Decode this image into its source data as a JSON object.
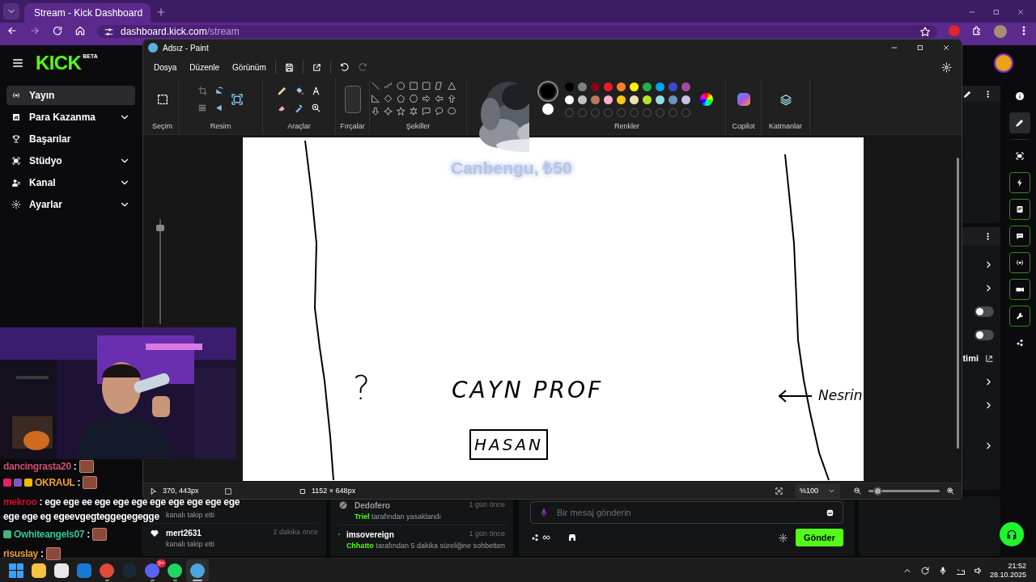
{
  "browser": {
    "tab": {
      "title": "Stream - Kick Dashboard"
    },
    "address": {
      "host": "dashboard.kick.com",
      "path": "/stream"
    }
  },
  "kick": {
    "logo": "KICK",
    "logo_badge": "BETA",
    "sidebar": [
      {
        "label": "Yayın",
        "selected": true,
        "expandable": false
      },
      {
        "label": "Para Kazanma",
        "selected": false,
        "expandable": true
      },
      {
        "label": "Başarılar",
        "selected": false,
        "expandable": false
      },
      {
        "label": "Stüdyo",
        "selected": false,
        "expandable": true
      },
      {
        "label": "Kanal",
        "selected": false,
        "expandable": true
      },
      {
        "label": "Ayarlar",
        "selected": false,
        "expandable": true
      }
    ],
    "right_panel": [
      {
        "kind": "chevron"
      },
      {
        "kind": "chevron"
      },
      {
        "kind": "toggle",
        "on": false
      },
      {
        "kind": "toggle",
        "on": false
      },
      {
        "kind": "link",
        "label": "timi"
      },
      {
        "kind": "chevron"
      },
      {
        "kind": "chevron"
      },
      {
        "kind": "gap"
      },
      {
        "kind": "chevron"
      }
    ],
    "activity": [
      {
        "text": "kanalı takip etti"
      },
      {
        "user": "mert2631",
        "time": "2 dakika önce",
        "text": "kanalı takip etti"
      }
    ],
    "mod_log": [
      {
        "kind": "ban",
        "user": "Dedofero",
        "time": "1 gün önce",
        "actor": "Triel",
        "action": "tarafından yasaklandı"
      },
      {
        "kind": "timeout",
        "user": "imsovereign",
        "time": "1 gün önce",
        "actor": "Chhatto",
        "action": "tarafından 5 dakika süreliğine sohbetten"
      }
    ],
    "chat_input": {
      "placeholder": "Bir mesaj gönderin",
      "send": "Gönder"
    },
    "rail": [
      {
        "selected": false,
        "outlined": false
      },
      {
        "selected": true,
        "outlined": false
      },
      {
        "selected": false,
        "outlined": false
      },
      {
        "selected": false,
        "outlined": true
      },
      {
        "selected": false,
        "outlined": true
      },
      {
        "selected": false,
        "outlined": true
      },
      {
        "selected": false,
        "outlined": true
      },
      {
        "selected": false,
        "outlined": true
      },
      {
        "selected": false,
        "outlined": true
      },
      {
        "selected": false,
        "outlined": false
      }
    ]
  },
  "paint": {
    "title": "Adsız - Paint",
    "menu": [
      "Dosya",
      "Düzenle",
      "Görünüm"
    ],
    "groups": [
      "Seçim",
      "Resim",
      "Araçlar",
      "Fırçalar",
      "Şekiller",
      "Renkler",
      "Copilot",
      "Katmanlar"
    ],
    "current_colors": [
      {
        "color": "#000000"
      },
      {
        "color": "#ffffff"
      }
    ],
    "colors": [
      {
        "color": "#000000"
      },
      {
        "color": "#7f7f7f"
      },
      {
        "color": "#880015"
      },
      {
        "color": "#ed1c24"
      },
      {
        "color": "#ff7f27"
      },
      {
        "color": "#fff200"
      },
      {
        "color": "#22b14c"
      },
      {
        "color": "#00a2e8"
      },
      {
        "color": "#3f48cc"
      },
      {
        "color": "#a349a4"
      },
      {
        "color": "#ffffff"
      },
      {
        "color": "#c3c3c3"
      },
      {
        "color": "#b97a57"
      },
      {
        "color": "#ffaec9"
      },
      {
        "color": "#ffc90e"
      },
      {
        "color": "#efe4b0"
      },
      {
        "color": "#b5e61d"
      },
      {
        "color": "#99d9ea"
      },
      {
        "color": "#7092be"
      },
      {
        "color": "#c8bfe7"
      }
    ],
    "canvas_texts": [
      {
        "kind": "plain",
        "text": "?"
      },
      {
        "kind": "plain",
        "text": "CAYN PROF"
      },
      {
        "kind": "boxed",
        "text": "HASAN"
      },
      {
        "kind": "arrow",
        "text": "Nesrin"
      }
    ],
    "status": {
      "cursor": "370, 443px",
      "size": "1152 × 648px"
    },
    "brush_size": {
      "level": 0.95
    },
    "zoom": {
      "label": "%100",
      "level": 0.12
    }
  },
  "alert": {
    "text": "Canbengu, ₺50"
  },
  "stream_chat": [
    {
      "user": "dancingrasta20",
      "color": "#d0507a",
      "separator": ":",
      "emote": true
    },
    {
      "user": "OKRAUL",
      "color": "#f5a623",
      "separator": ":",
      "emote": true,
      "badges": [
        {
          "color": "#e91e63"
        },
        {
          "color": "#7e57c2"
        },
        {
          "color": "#f5b800"
        }
      ]
    },
    {
      "user": "mekroo",
      "color": "#c8102e",
      "separator": ":",
      "emote": false,
      "lines": [
        "ege ege ee ege ege ege ege ege ege ege ege",
        "ege ege eg egeevgegteggegegegge"
      ]
    },
    {
      "user": "Owhiteangels07",
      "color": "#2ecc9a",
      "separator": ":",
      "emote": true,
      "badges": [
        {
          "color": "#43b581"
        }
      ]
    },
    {
      "user": "risuslay",
      "color": "#e8a33d",
      "separator": ":",
      "emote": true
    }
  ],
  "taskbar": {
    "apps": [
      {
        "running": false,
        "active": false
      },
      {
        "running": false,
        "active": false
      },
      {
        "running": false,
        "active": false
      },
      {
        "running": false,
        "active": false
      },
      {
        "running": true,
        "active": false
      },
      {
        "running": false,
        "active": false
      },
      {
        "running": true,
        "active": false,
        "badge": "9+"
      },
      {
        "running": true,
        "active": false
      },
      {
        "running": true,
        "active": true
      }
    ],
    "time": "21:52",
    "date": "28.10.2025"
  }
}
